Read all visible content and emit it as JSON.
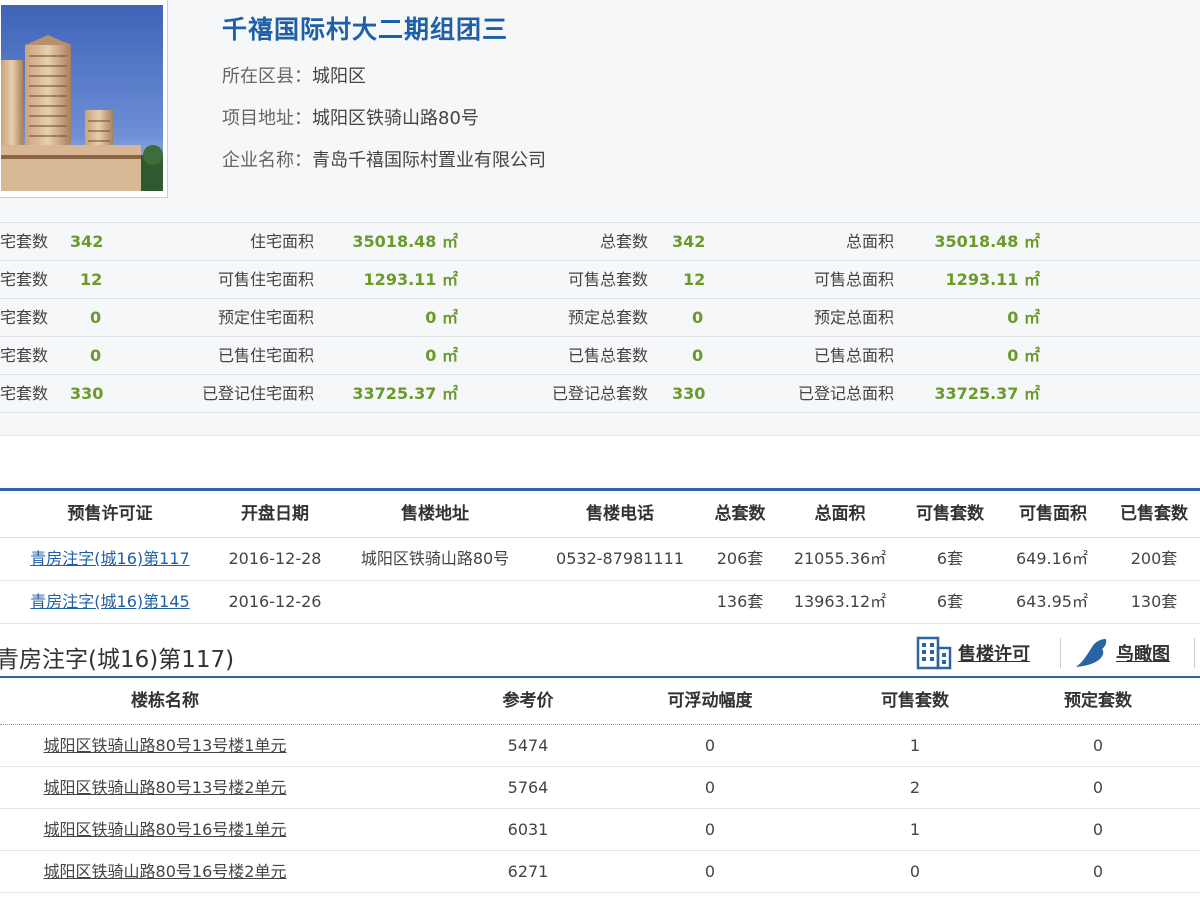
{
  "project": {
    "title": "千禧国际村大二期组团三",
    "district_label": "所在区县：",
    "district": "城阳区",
    "address_label": "项目地址：",
    "address": "城阳区铁骑山路80号",
    "company_label": "企业名称：",
    "company": "青岛千禧国际村置业有限公司"
  },
  "summary": {
    "rows": [
      {
        "l1": "宅套数",
        "v1": "342",
        "l2": "住宅面积",
        "v2": "35018.48 ㎡",
        "l3": "总套数",
        "v3": "342",
        "l4": "总面积",
        "v4": "35018.48 ㎡"
      },
      {
        "l1": "宅套数",
        "v1": "12",
        "l2": "可售住宅面积",
        "v2": "1293.11 ㎡",
        "l3": "可售总套数",
        "v3": "12",
        "l4": "可售总面积",
        "v4": "1293.11 ㎡"
      },
      {
        "l1": "宅套数",
        "v1": "0",
        "l2": "预定住宅面积",
        "v2": "0 ㎡",
        "l3": "预定总套数",
        "v3": "0",
        "l4": "预定总面积",
        "v4": "0 ㎡"
      },
      {
        "l1": "宅套数",
        "v1": "0",
        "l2": "已售住宅面积",
        "v2": "0 ㎡",
        "l3": "已售总套数",
        "v3": "0",
        "l4": "已售总面积",
        "v4": "0 ㎡"
      },
      {
        "l1": "宅套数",
        "v1": "330",
        "l2": "已登记住宅面积",
        "v2": "33725.37 ㎡",
        "l3": "已登记总套数",
        "v3": "330",
        "l4": "已登记总面积",
        "v4": "33725.37 ㎡"
      }
    ]
  },
  "permits": {
    "headers": [
      "预售许可证",
      "开盘日期",
      "售楼地址",
      "售楼电话",
      "总套数",
      "总面积",
      "可售套数",
      "可售面积",
      "已售套数"
    ],
    "rows": [
      [
        "青房注字(城16)第117",
        "2016-12-28",
        "城阳区铁骑山路80号",
        "0532-87981111",
        "206套",
        "21055.36㎡",
        "6套",
        "649.16㎡",
        "200套"
      ],
      [
        "青房注字(城16)第145",
        "2016-12-26",
        "",
        "",
        "136套",
        "13963.12㎡",
        "6套",
        "643.95㎡",
        "130套"
      ]
    ]
  },
  "section": {
    "title": "青房注字(城16)第117)",
    "sale_permit_label": "售楼许可",
    "birdview_label": "鸟瞰图"
  },
  "buildings": {
    "headers": [
      "楼栋名称",
      "参考价",
      "可浮动幅度",
      "可售套数",
      "预定套数"
    ],
    "rows": [
      [
        "城阳区铁骑山路80号13号楼1单元",
        "5474",
        "0",
        "1",
        "0"
      ],
      [
        "城阳区铁骑山路80号13号楼2单元",
        "5764",
        "0",
        "2",
        "0"
      ],
      [
        "城阳区铁骑山路80号16号楼1单元",
        "6031",
        "0",
        "1",
        "0"
      ],
      [
        "城阳区铁骑山路80号16号楼2单元",
        "6271",
        "0",
        "0",
        "0"
      ]
    ]
  },
  "colors": {
    "accent": "#2b64a2",
    "link": "#1f5fa8",
    "number": "#6a9a2a"
  }
}
